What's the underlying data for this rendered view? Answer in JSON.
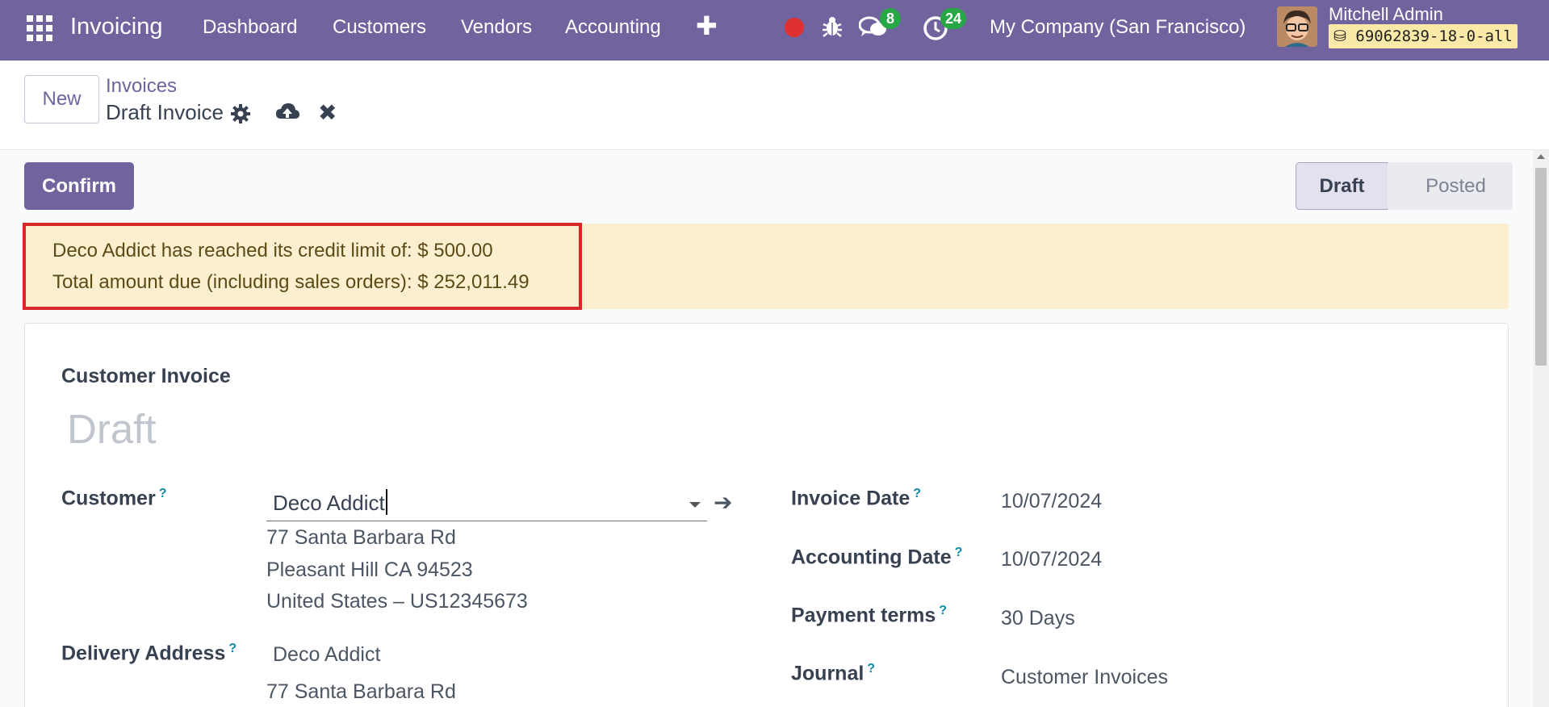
{
  "navbar": {
    "app_name": "Invoicing",
    "menu": [
      "Dashboard",
      "Customers",
      "Vendors",
      "Accounting"
    ],
    "messages_count": "8",
    "activities_count": "24",
    "company": "My Company (San Francisco)",
    "user_name": "Mitchell Admin",
    "database": "69062839-18-0-all",
    "color": "#71639e"
  },
  "control_panel": {
    "new_label": "New",
    "breadcrumb_parent": "Invoices",
    "breadcrumb_current": "Draft Invoice"
  },
  "actions": {
    "confirm_label": "Confirm"
  },
  "statusbar": {
    "stages": [
      "Draft",
      "Posted"
    ],
    "current": "Draft"
  },
  "alert": {
    "line1": "Deco Addict has reached its credit limit of: $ 500.00",
    "line2": "Total amount due (including sales orders): $ 252,011.49"
  },
  "form": {
    "doc_type": "Customer Invoice",
    "doc_name": "Draft",
    "customer_label": "Customer",
    "customer_value": "Deco Addict",
    "customer_address": [
      "77 Santa Barbara Rd",
      "Pleasant Hill CA 94523",
      "United States – US12345673"
    ],
    "delivery_label": "Delivery Address",
    "delivery_name": "Deco Addict",
    "delivery_address_line": "77 Santa Barbara Rd",
    "invoice_date_label": "Invoice Date",
    "invoice_date": "10/07/2024",
    "accounting_date_label": "Accounting Date",
    "accounting_date": "10/07/2024",
    "payment_terms_label": "Payment terms",
    "payment_terms": "30 Days",
    "journal_label": "Journal",
    "journal": "Customer Invoices",
    "help_marker": "?"
  }
}
